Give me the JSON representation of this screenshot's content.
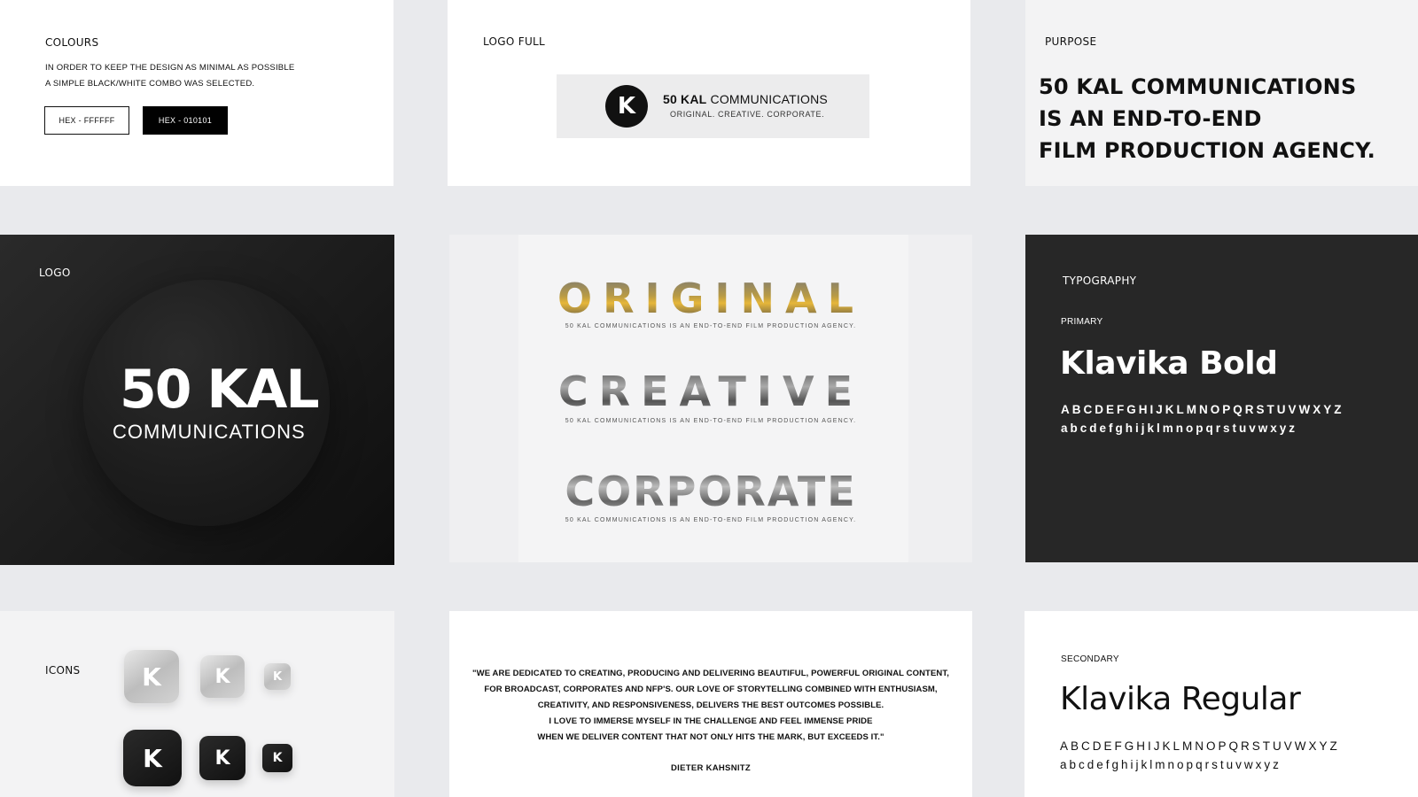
{
  "colours": {
    "label": "COLOURS",
    "desc_line1": "IN ORDER TO KEEP THE DESIGN AS MINIMAL AS POSSIBLE",
    "desc_line2": "A SIMPLE BLACK/WHITE COMBO WAS SELECTED.",
    "swatch_white": "HEX - FFFFFF",
    "swatch_black": "HEX - 010101",
    "white_hex": "#FFFFFF",
    "black_hex": "#010101"
  },
  "logo_full": {
    "label": "LOGO FULL",
    "mark": "K",
    "name_bold": "50 KAL",
    "name_rest": "COMMUNICATIONS",
    "tagline": "ORIGINAL. CREATIVE. CORPORATE."
  },
  "purpose": {
    "label": "PURPOSE",
    "line1": "50 KAL COMMUNICATIONS",
    "line2": "IS AN END-TO-END",
    "line3": "FILM PRODUCTION AGENCY."
  },
  "logo": {
    "label": "LOGO",
    "name": "50 KAL",
    "sub": "COMMUNICATIONS"
  },
  "words": {
    "word1": "ORIGINAL",
    "word2": "CREATIVE",
    "word3": "CORPORATE",
    "sub": "50 KAL COMMUNICATIONS IS AN END-TO-END FILM PRODUCTION AGENCY."
  },
  "typography": {
    "label": "TYPOGRAPHY",
    "primary_label": "PRIMARY",
    "primary_font": "Klavika Bold",
    "upper": "ABCDEFGHIJKLMNOPQRSTUVWXYZ",
    "lower": "abcdefghijklmnopqrstuvwxyz",
    "secondary_label": "SECONDARY",
    "secondary_font": "Klavika Regular"
  },
  "icons": {
    "label": "ICONS",
    "mark": "K"
  },
  "quote": {
    "line1": "\"WE ARE DEDICATED TO CREATING, PRODUCING AND DELIVERING BEAUTIFUL, POWERFUL ORIGINAL CONTENT,",
    "line2": "FOR BROADCAST, CORPORATES AND NFP'S. OUR LOVE OF STORYTELLING COMBINED WITH ENTHUSIASM,",
    "line3": "CREATIVITY, AND RESPONSIVENESS, DELIVERS THE BEST OUTCOMES POSSIBLE.",
    "line4": "I LOVE TO IMMERSE MYSELF IN THE CHALLENGE AND FEEL IMMENSE PRIDE",
    "line5": "WHEN WE DELIVER CONTENT THAT NOT ONLY HITS THE MARK, BUT EXCEEDS IT.\"",
    "author": "DIETER KAHSNITZ"
  }
}
